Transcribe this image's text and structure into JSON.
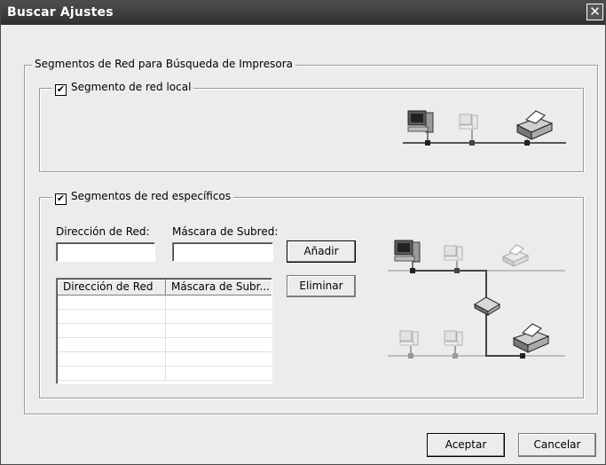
{
  "window": {
    "title": "Buscar Ajustes",
    "close_glyph": "✕"
  },
  "main_group": {
    "legend": "Segmentos de Red para Búsqueda de Impresora"
  },
  "local_group": {
    "checkbox_label": "Segmento de red local",
    "checked": true,
    "check_glyph": "✔"
  },
  "specific_group": {
    "checkbox_label": "Segmentos de red específicos",
    "checked": true,
    "check_glyph": "✔",
    "network_address_label": "Dirección de Red:",
    "network_address_value": "",
    "subnet_mask_label": "Máscara de Subred:",
    "subnet_mask_value": "",
    "add_label": "Añadir",
    "remove_label": "Eliminar",
    "table": {
      "columns": [
        "Dirección de Red",
        "Máscara de Subr..."
      ],
      "rows": []
    }
  },
  "footer": {
    "ok_label": "Aceptar",
    "cancel_label": "Cancelar"
  },
  "icons": {
    "local_diagram": "local-network-diagram-icon",
    "specific_diagram": "routed-network-diagram-icon"
  }
}
